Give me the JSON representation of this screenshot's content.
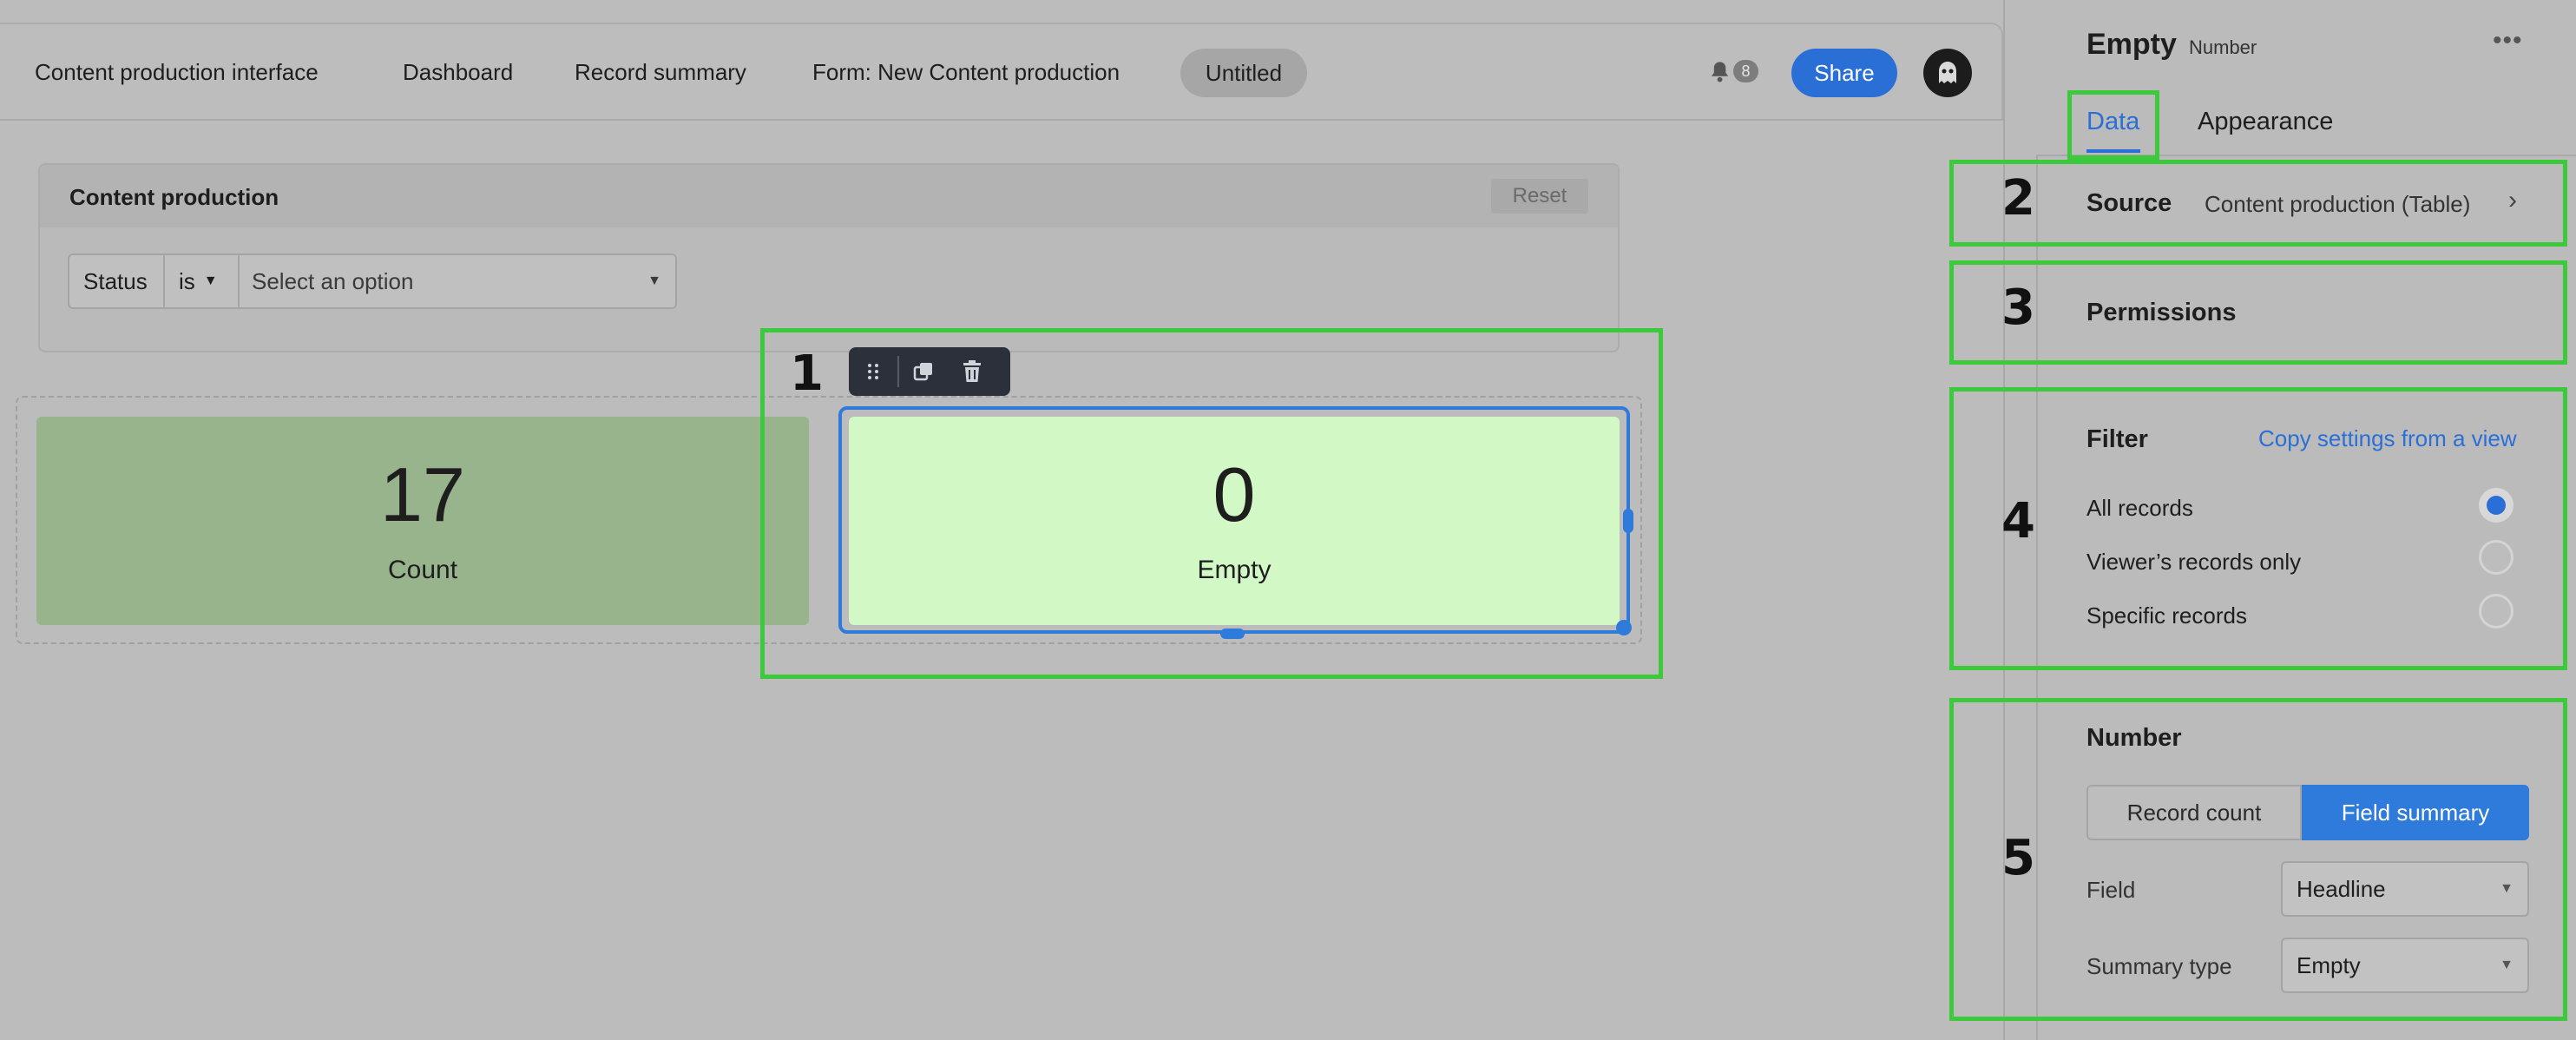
{
  "nav": {
    "items": [
      "Content production interface",
      "Dashboard",
      "Record summary",
      "Form: New Content production"
    ],
    "active": "Untitled",
    "notifications": "8",
    "share_label": "Share"
  },
  "filter_card": {
    "title": "Content production",
    "reset_label": "Reset",
    "field": "Status",
    "operator": "is",
    "value_placeholder": "Select an option"
  },
  "cards": [
    {
      "value": "17",
      "label": "Count"
    },
    {
      "value": "0",
      "label": "Empty"
    }
  ],
  "panel": {
    "title": "Empty",
    "subtitle": "Number",
    "more": "•••",
    "tabs": [
      "Data",
      "Appearance"
    ],
    "source_label": "Source",
    "source_value": "Content production (Table)",
    "permissions_label": "Permissions",
    "filter_label": "Filter",
    "filter_link": "Copy settings from a view",
    "record_options": [
      {
        "label": "All records",
        "selected": true
      },
      {
        "label": "Viewer’s records only",
        "selected": false
      },
      {
        "label": "Specific records",
        "selected": false
      }
    ],
    "number_label": "Number",
    "segments": [
      "Record count",
      "Field summary"
    ],
    "active_segment": "Field summary",
    "field_label": "Field",
    "field_value": "Headline",
    "summary_label": "Summary type",
    "summary_value": "Empty"
  },
  "annotations": [
    "1",
    "2",
    "3",
    "4",
    "5"
  ],
  "colors": {
    "accent": "#2a6fd6",
    "annotation": "#3cc93c",
    "card_count": "#97b48d",
    "card_empty": "#d2f8c6"
  }
}
